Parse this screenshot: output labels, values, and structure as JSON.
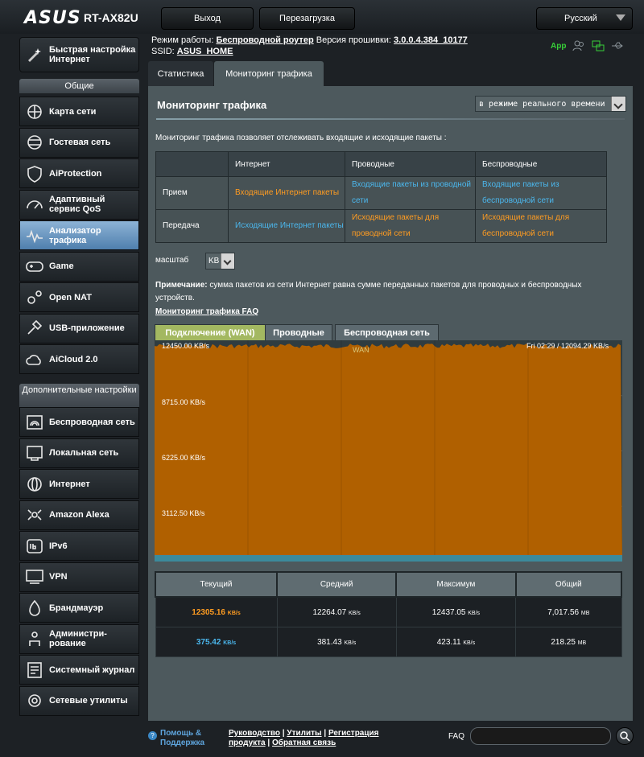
{
  "header": {
    "brand": "ASUS",
    "model": "RT-AX82U",
    "logout": "Выход",
    "reboot": "Перезагрузка",
    "language": "Русский"
  },
  "info": {
    "mode_label": "Режим работы:",
    "mode_value": "Беспроводной роутер",
    "fw_label": "Версия прошивки:",
    "fw_value": "3.0.0.4.384_10177",
    "ssid_label": "SSID:",
    "ssid_value": "ASUS_HOME",
    "app": "App"
  },
  "sidebar": {
    "quick": "Быстрая настройка Интернет",
    "general_header": "Общие",
    "advanced_header": "Дополнительные настройки",
    "general": [
      {
        "label": "Карта сети",
        "icon": "network-map-icon"
      },
      {
        "label": "Гостевая сеть",
        "icon": "guest-network-icon"
      },
      {
        "label": "AiProtection",
        "icon": "shield-icon"
      },
      {
        "label": "Адаптивный сервис QoS",
        "icon": "qos-gauge-icon"
      },
      {
        "label": "Анализатор трафика",
        "icon": "traffic-analyzer-icon"
      },
      {
        "label": "Game",
        "icon": "gamepad-icon"
      },
      {
        "label": "Open NAT",
        "icon": "open-nat-icon"
      },
      {
        "label": "USB-приложение",
        "icon": "usb-icon"
      },
      {
        "label": "AiCloud 2.0",
        "icon": "cloud-icon"
      }
    ],
    "advanced": [
      {
        "label": "Беспроводная сеть",
        "icon": "wireless-icon"
      },
      {
        "label": "Локальная сеть",
        "icon": "lan-icon"
      },
      {
        "label": "Интернет",
        "icon": "globe-icon"
      },
      {
        "label": "Amazon Alexa",
        "icon": "alexa-icon"
      },
      {
        "label": "IPv6",
        "icon": "ipv6-icon"
      },
      {
        "label": "VPN",
        "icon": "vpn-icon"
      },
      {
        "label": "Брандмауэр",
        "icon": "firewall-icon"
      },
      {
        "label": "Администри-рование",
        "icon": "admin-icon"
      },
      {
        "label": "Системный журнал",
        "icon": "system-log-icon"
      },
      {
        "label": "Сетевые утилиты",
        "icon": "network-tools-icon"
      }
    ]
  },
  "tabs": [
    "Статистика",
    "Мониторинг трафика"
  ],
  "main": {
    "title": "Мониторинг трафика",
    "mode_select": "в режиме реального времени",
    "description": "Мониторинг трафика позволяет отслеживать входящие и исходящие пакеты :",
    "legend": {
      "cols": [
        "Интернет",
        "Проводные",
        "Беспроводные"
      ],
      "rows": [
        {
          "label": "Прием",
          "cells": [
            "Входящие Интернет пакеты",
            "Входящие пакеты из проводной сети",
            "Входящие пакеты из беспроводной сети"
          ]
        },
        {
          "label": "Передача",
          "cells": [
            "Исходящие Интернет пакеты",
            "Исходящие пакеты для проводной сети",
            "Исходящие пакеты для беспроводной сети"
          ]
        }
      ]
    },
    "scale_label": "масштаб",
    "scale_value": "KB",
    "note_label": "Примечание:",
    "note_text": " сумма пакетов из сети Интернет равна сумме переданных пакетов для проводных и беспроводных устройств.",
    "faq_link": "Мониторинг трафика FAQ",
    "graph_tabs": [
      "Подключение (WAN)",
      "Проводные",
      "Беспроводная сеть"
    ],
    "graph": {
      "max_label": "12450.00 KB/s",
      "y_labels": [
        "8715.00 KB/s",
        "6225.00 KB/s",
        "3112.50 KB/s"
      ],
      "series_label": "WAN",
      "readout": "Fri 02:29 / 12094.29 KB/s",
      "fill_color": "#b06000",
      "rx_level_fraction": 0.985
    },
    "stats": {
      "headers": [
        "Текущий",
        "Средний",
        "Максимум",
        "Общий"
      ],
      "rows": [
        {
          "cur": "12305.16",
          "cur_unit": "KB/s",
          "avg": "12264.07",
          "avg_unit": "KB/s",
          "max": "12437.05",
          "max_unit": "KB/s",
          "total": "7,017.56",
          "total_unit": "MB"
        },
        {
          "cur": "375.42",
          "cur_unit": "KB/s",
          "avg": "381.43",
          "avg_unit": "KB/s",
          "max": "423.11",
          "max_unit": "KB/s",
          "total": "218.25",
          "total_unit": "MB"
        }
      ]
    }
  },
  "footer": {
    "help": "Помощь & Поддержка",
    "links_line1": [
      "Руководство",
      "Утилиты",
      "Регистрация"
    ],
    "links_line2": [
      "продукта",
      "Обратная связь"
    ],
    "faq": "FAQ"
  }
}
